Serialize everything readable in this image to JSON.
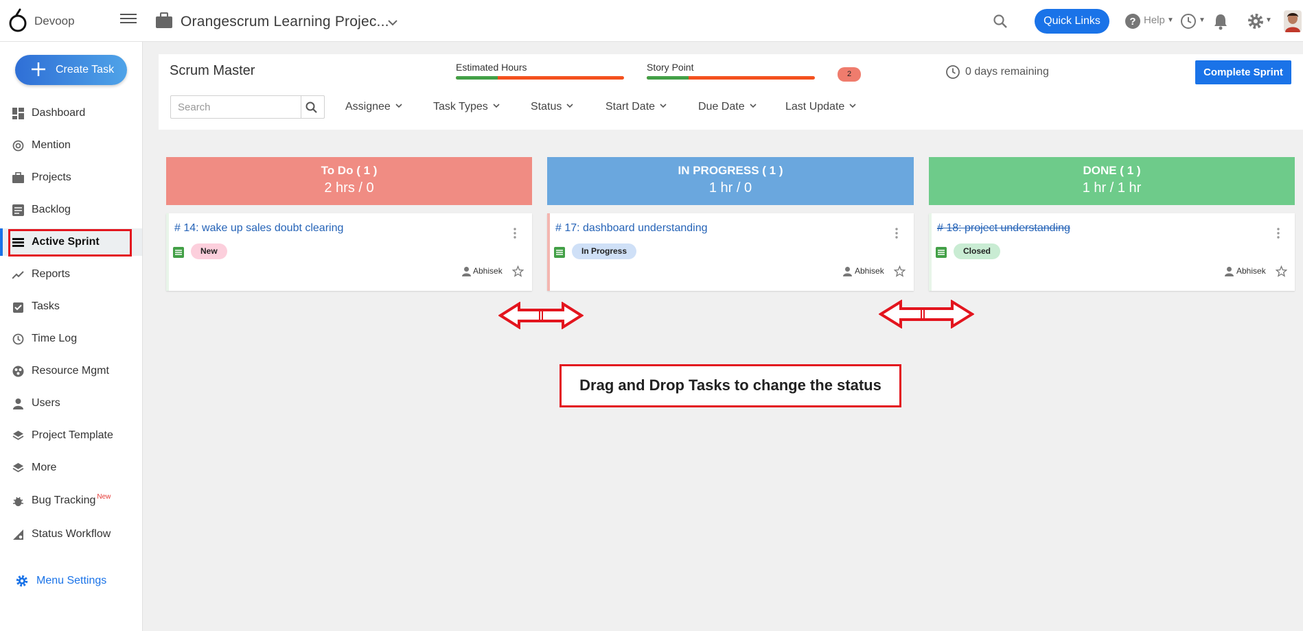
{
  "header": {
    "company": "Devoop",
    "project_title": "Orangescrum Learning Projec...",
    "quick_links": "Quick Links",
    "help": "Help"
  },
  "sidebar": {
    "create_task": "Create Task",
    "items": [
      {
        "label": "Dashboard",
        "icon": "dashboard-icon"
      },
      {
        "label": "Mention",
        "icon": "at-icon"
      },
      {
        "label": "Projects",
        "icon": "briefcase-icon"
      },
      {
        "label": "Backlog",
        "icon": "backlog-icon"
      },
      {
        "label": "Active Sprint",
        "icon": "sprint-icon",
        "active": true
      },
      {
        "label": "Reports",
        "icon": "trend-icon"
      },
      {
        "label": "Tasks",
        "icon": "clipboard-check-icon"
      },
      {
        "label": "Time Log",
        "icon": "clock-icon"
      },
      {
        "label": "Resource Mgmt",
        "icon": "resource-icon"
      },
      {
        "label": "Users",
        "icon": "user-icon"
      },
      {
        "label": "Project Template",
        "icon": "layers-icon"
      },
      {
        "label": "More",
        "icon": "layers-icon"
      },
      {
        "label": "Bug Tracking",
        "icon": "bug-icon",
        "badge": "New"
      },
      {
        "label": "Status Workflow",
        "icon": "workflow-icon"
      }
    ],
    "menu_settings": "Menu Settings"
  },
  "sprint": {
    "title": "Scrum Master",
    "estimated_hours_label": "Estimated Hours",
    "estimated_hours_progress": 0.25,
    "story_point_label": "Story Point",
    "story_point_progress": 0.25,
    "story_point_badge": "2",
    "days_remaining": "0 days remaining",
    "complete_button": "Complete Sprint"
  },
  "filters": {
    "search_placeholder": "Search",
    "items": [
      "Assignee",
      "Task Types",
      "Status",
      "Start Date",
      "Due Date",
      "Last Update"
    ]
  },
  "columns": [
    {
      "title": "To Do ( 1 )",
      "hours": "2 hrs / 0",
      "color": "#f08c83",
      "card": {
        "title": "# 14: wake up sales doubt clearing",
        "status": "New",
        "status_color": "#fccfdc",
        "assignee": "Abhisek",
        "strike": false,
        "accent": "#e8f5e9"
      }
    },
    {
      "title": "IN PROGRESS ( 1 )",
      "hours": "1 hr / 0",
      "color": "#6aa7de",
      "card": {
        "title": "# 17: dashboard understanding",
        "status": "In Progress",
        "status_color": "#cfe0f7",
        "assignee": "Abhisek",
        "strike": false,
        "accent": "#f4b6b0"
      }
    },
    {
      "title": "DONE ( 1 )",
      "hours": "1 hr / 1 hr",
      "color": "#6ecb8a",
      "card": {
        "title": "# 18: project understanding",
        "status": "Closed",
        "status_color": "#c9ecd3",
        "assignee": "Abhisek",
        "strike": true,
        "accent": "#e8f5e9"
      }
    }
  ],
  "annotation": {
    "note": "Drag and Drop Tasks to change the status",
    "color": "#e3151e"
  }
}
